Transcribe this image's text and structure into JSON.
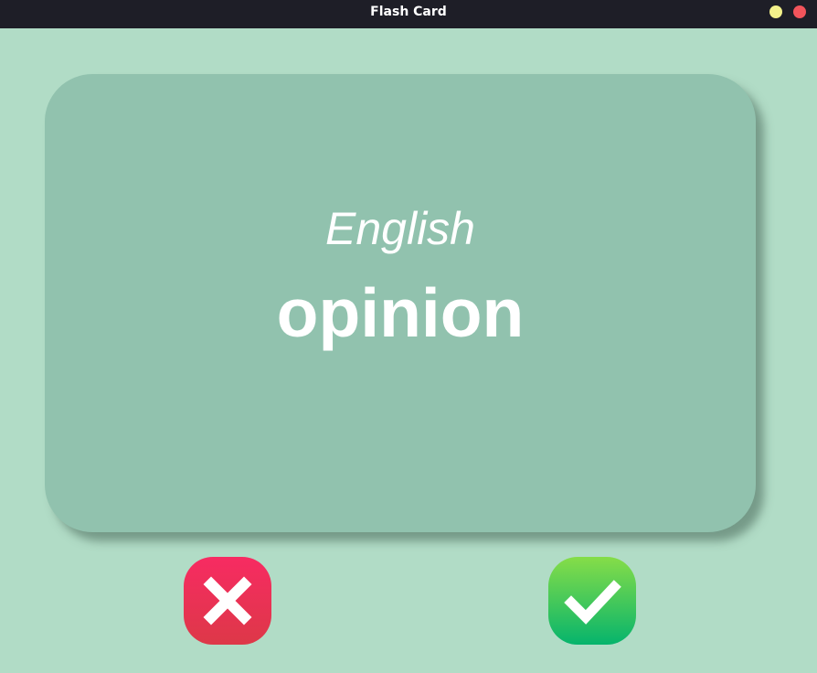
{
  "window": {
    "title": "Flash Card",
    "controls": [
      "minimize",
      "close"
    ]
  },
  "card": {
    "title": "English",
    "word": "opinion"
  },
  "actions": {
    "wrong": {
      "icon": "x-icon",
      "color": "#f0305b"
    },
    "right": {
      "icon": "checkmark-icon",
      "color": "#3fc85a"
    }
  },
  "colors": {
    "background": "#b1dcc6",
    "card": "#91c2ae",
    "titlebar": "#1e1e27"
  }
}
